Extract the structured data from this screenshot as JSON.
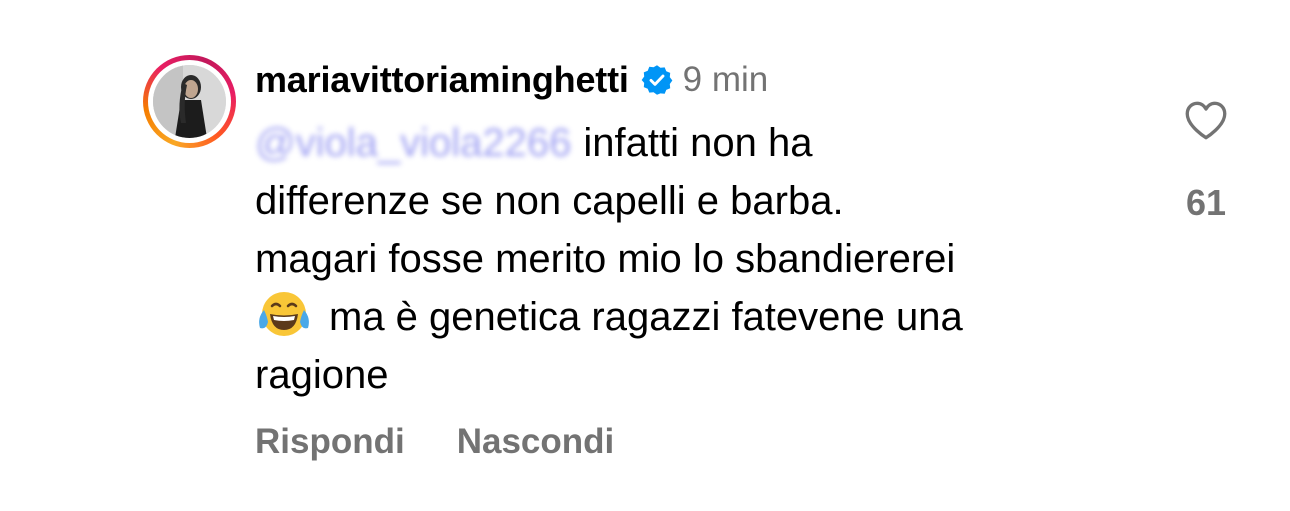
{
  "comment": {
    "username": "mariavittoriaminghetti",
    "verified": true,
    "timestamp": "9 min",
    "mention": "@viola_viola2266",
    "text_line1": "infatti non ha",
    "text_line2": "differenze se non capelli e barba.",
    "text_line3": "magari fosse merito mio lo sbandiererei",
    "text_line4": "ma è genetica ragazzi fatevene una",
    "text_line5": "ragione",
    "emoji": "face-with-tears-of-joy-emoji",
    "like_count": "61",
    "liked": false
  },
  "actions": {
    "reply_label": "Rispondi",
    "hide_label": "Nascondi"
  },
  "colors": {
    "verified_badge": "#0095f6",
    "secondary_text": "#737373",
    "mention_blurred": "#8a8cf0"
  }
}
